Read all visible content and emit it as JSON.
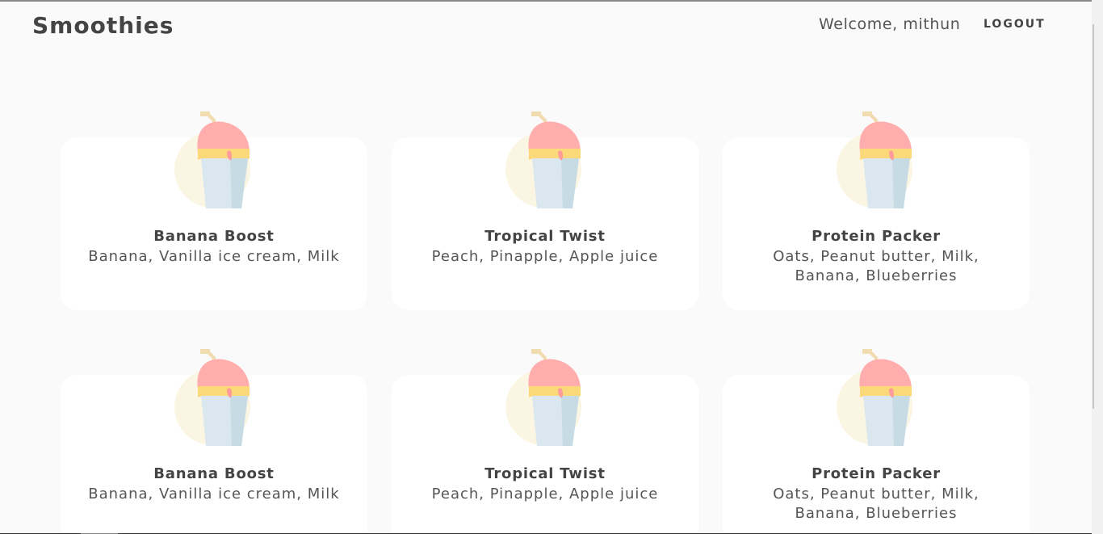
{
  "header": {
    "brand": "Smoothies",
    "welcome": "Welcome, mithun",
    "logout_label": "LOGOUT"
  },
  "smoothies": [
    {
      "title": "Banana Boost",
      "ingredients": "Banana, Vanilla ice cream, Milk",
      "icon": "smoothie-cup-icon"
    },
    {
      "title": "Tropical Twist",
      "ingredients": "Peach, Pinapple, Apple juice",
      "icon": "smoothie-cup-icon"
    },
    {
      "title": "Protein Packer",
      "ingredients": "Oats, Peanut butter, Milk, Banana, Blueberries",
      "icon": "smoothie-cup-icon"
    },
    {
      "title": "Banana Boost",
      "ingredients": "Banana, Vanilla ice cream, Milk",
      "icon": "smoothie-cup-icon"
    },
    {
      "title": "Tropical Twist",
      "ingredients": "Peach, Pinapple, Apple juice",
      "icon": "smoothie-cup-icon"
    },
    {
      "title": "Protein Packer",
      "ingredients": "Oats, Peanut butter, Milk, Banana, Blueberries",
      "icon": "smoothie-cup-icon"
    }
  ],
  "colors": {
    "page_bg": "#fafafa",
    "card_bg": "#ffffff",
    "smoothie_top": "#ffadad",
    "cup": "#dbe7ee",
    "cup_shade": "#c7dbe4",
    "rim": "#fbd87a",
    "straw": "#f0dcb0",
    "halo": "#fbf6e4"
  }
}
